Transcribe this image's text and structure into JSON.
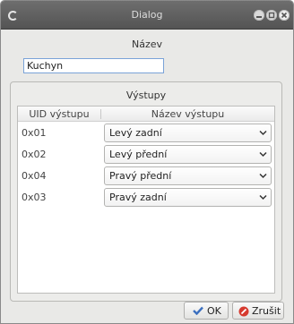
{
  "window": {
    "title": "Dialog"
  },
  "form": {
    "name_label": "Název",
    "name_value": "Kuchyn"
  },
  "outputs": {
    "group_title": "Výstupy",
    "columns": [
      "UID výstupu",
      "Název výstupu"
    ],
    "rows": [
      {
        "uid": "0x01",
        "name": "Levý zadní"
      },
      {
        "uid": "0x02",
        "name": "Levý přední"
      },
      {
        "uid": "0x04",
        "name": "Pravý přední"
      },
      {
        "uid": "0x03",
        "name": "Pravý zadní"
      }
    ]
  },
  "buttons": {
    "ok_label": "OK",
    "cancel_label": "Zrušit"
  },
  "colors": {
    "ok_icon": "#3b6fbf",
    "cancel_icon": "#d63a2f"
  }
}
